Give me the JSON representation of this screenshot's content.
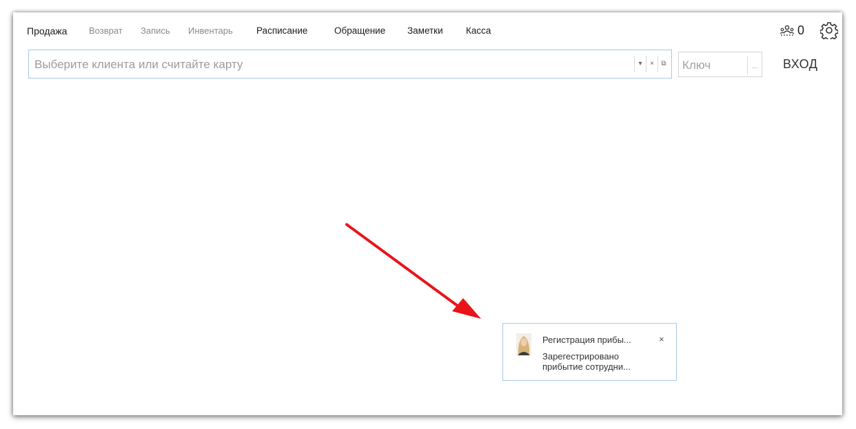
{
  "nav": {
    "items": [
      {
        "label": "Продажа",
        "state": "active"
      },
      {
        "label": "Возврат",
        "state": "disabled"
      },
      {
        "label": "Запись",
        "state": "disabled"
      },
      {
        "label": "Инвентарь",
        "state": "disabled"
      },
      {
        "label": "Расписание",
        "state": "enabled"
      },
      {
        "label": "Обращение",
        "state": "enabled"
      },
      {
        "label": "Заметки",
        "state": "enabled"
      },
      {
        "label": "Касса",
        "state": "enabled"
      }
    ],
    "users_count": "0",
    "users_icon": "users-icon",
    "settings_icon": "gear-icon"
  },
  "client": {
    "placeholder": "Выберите клиента или считайте карту",
    "value": "",
    "dropdown_glyph": "▾",
    "clear_glyph": "×",
    "open_glyph": "⧉"
  },
  "key": {
    "placeholder": "Ключ",
    "value": "",
    "browse_glyph": "..."
  },
  "login_label": "ВХОД",
  "notification": {
    "title": "Регистрация прибы...",
    "body": "Зарегестрировано прибытие сотрудни...",
    "close_glyph": "×",
    "avatar_icon": "employee-avatar"
  },
  "colors": {
    "accent_border": "#a9c6e8",
    "arrow": "#e8141a"
  }
}
